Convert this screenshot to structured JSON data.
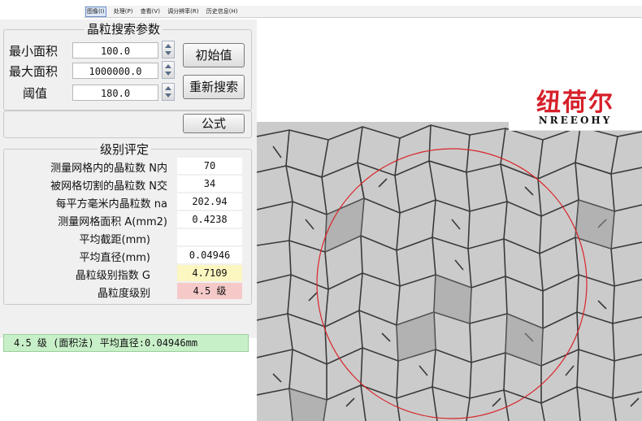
{
  "menu": [
    "图像(I)",
    "处理(P)",
    "查看(V)",
    "调分辨率(R)",
    "历史信息(H)"
  ],
  "search_group": {
    "title": "晶粒搜索参数",
    "min_area_label": "最小面积",
    "min_area_value": "100.0",
    "max_area_label": "最大面积",
    "max_area_value": "1000000.0",
    "threshold_label": "阈值",
    "threshold_value": "180.0",
    "initial_button": "初始值",
    "research_button": "重新搜索"
  },
  "formula_button": "公式",
  "grade_group": {
    "title": "级别评定",
    "rows": [
      {
        "label": "测量网格内的晶粒数 N内",
        "value": "70"
      },
      {
        "label": "被网格切割的晶粒数 N交",
        "value": "34"
      },
      {
        "label": "每平方毫米内晶粒数 na",
        "value": "202.94"
      },
      {
        "label": "测量网格面积 A(mm2)",
        "value": "0.4238"
      },
      {
        "label": "平均截距(mm)",
        "value": ""
      },
      {
        "label": "平均直径(mm)",
        "value": "0.04946"
      },
      {
        "label": "晶粒级别指数 G",
        "value": "4.7109"
      },
      {
        "label": "晶粒度级别",
        "value": "4.5 级"
      }
    ],
    "highlight_colors": {
      "index": "#fcf6c0",
      "grade": "#f6c9c9"
    }
  },
  "status_text": "4.5 级 (面积法) 平均直径:0.04946mm",
  "logo": {
    "cn": "纽荷尔",
    "en": "NREEOHY"
  },
  "colors": {
    "circle": "#d9252a",
    "status_bg": "#c8f0c8",
    "brand_red": "#d6202a"
  }
}
